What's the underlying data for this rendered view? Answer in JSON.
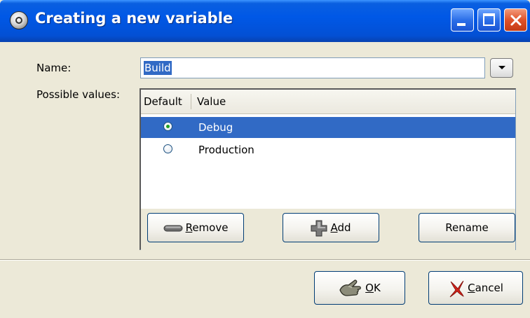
{
  "window": {
    "title": "Creating a new variable"
  },
  "form": {
    "name_label": "Name:",
    "name_value": "Build",
    "values_label": "Possible values:"
  },
  "table": {
    "columns": [
      "Default",
      "Value"
    ],
    "rows": [
      {
        "default": true,
        "value": "Debug",
        "selected": true
      },
      {
        "default": false,
        "value": "Production",
        "selected": false
      }
    ]
  },
  "list_buttons": {
    "remove": {
      "mnemonic": "R",
      "rest": "emove"
    },
    "add": {
      "mnemonic": "A",
      "rest": "dd"
    },
    "rename": "Rename"
  },
  "dialog_buttons": {
    "ok": {
      "mnemonic": "O",
      "rest": "K"
    },
    "cancel": {
      "mnemonic": "C",
      "rest": "ancel"
    }
  },
  "colors": {
    "titlebar": "#0058e6",
    "selection": "#316ac5",
    "dialog_bg": "#ece9d8"
  },
  "icons": {
    "app": "gps-app-icon",
    "remove": "minus-icon",
    "add": "plus-icon",
    "ok": "hand-ok-icon",
    "cancel": "red-x-icon"
  }
}
